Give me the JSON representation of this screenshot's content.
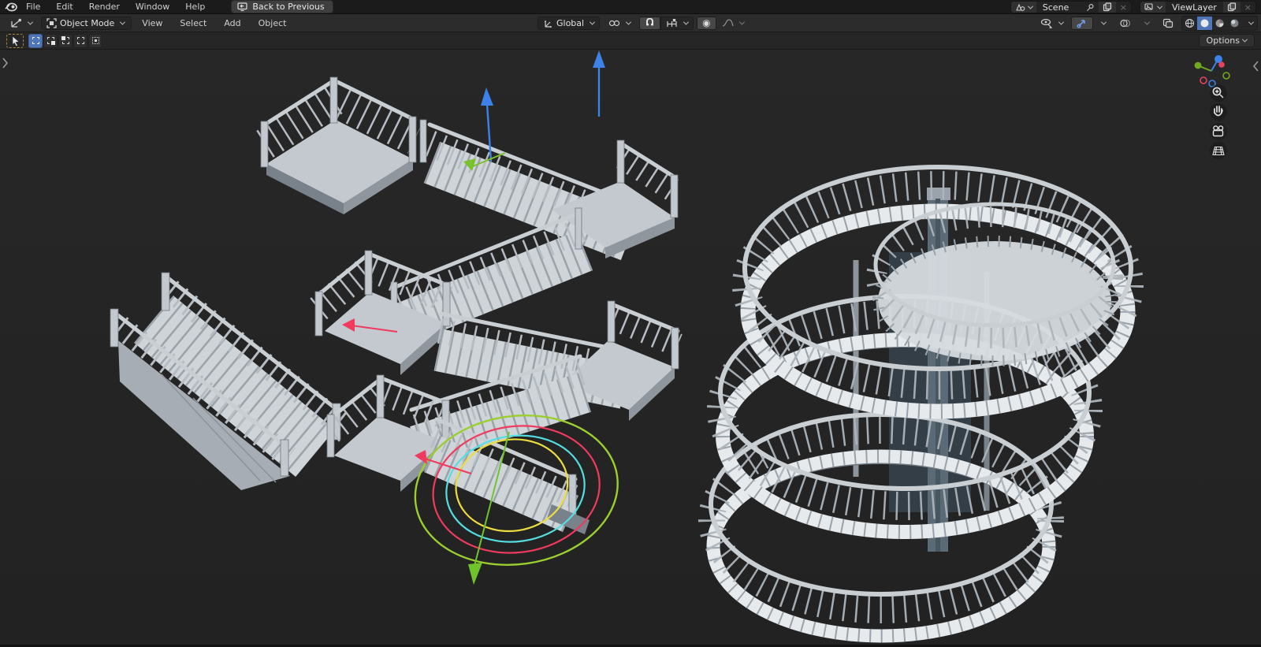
{
  "topbar": {
    "menus": [
      "File",
      "Edit",
      "Render",
      "Window",
      "Help"
    ],
    "back_button": "Back to Previous",
    "scene_name": "Scene",
    "view_layer_name": "ViewLayer",
    "close_glyph": "×"
  },
  "header": {
    "mode": "Object Mode",
    "menus": [
      "View",
      "Select",
      "Add",
      "Object"
    ],
    "orientation": "Global",
    "options_button": "Options",
    "proportional_glyph": "◉"
  },
  "colors": {
    "accent_blue": "#4f76b8",
    "axis_x_red": "#f03a5e",
    "axis_y_green": "#7ac12c",
    "axis_z_blue": "#3d82e8",
    "ring_green": "#9bce2f",
    "ring_red": "#f03a5e",
    "ring_cyan": "#55dee2",
    "ring_yellow": "#eddd40",
    "header_bg": "#2c2c2c",
    "topbar_bg": "#1b1b1b",
    "viewport_bg": "#242424"
  },
  "icons": {
    "blender-logo": "orange app logo",
    "back-icon": "monitor with left arrow",
    "editor-type-icon": "3d viewport axes",
    "object-mode-icon": "bracketed square",
    "orientation-icon": "global axes",
    "pivot-icon": "linked circles",
    "snap-magnet-icon": "magnet (enabled)",
    "snap-target-icon": "increment markers",
    "proportional-icon": "◉",
    "falloff-icon": "curve",
    "visibility-icon": "eye with cursor",
    "gizmo-icon": "blue arrow gizmo",
    "overlays-icon": "overlapping circles",
    "xray-icon": "overlapping squares",
    "shading-wireframe-icon": "wire sphere",
    "shading-solid-icon": "solid sphere (active)",
    "shading-material-icon": "checker sphere",
    "shading-rendered-icon": "shaded sphere",
    "scene-icon": "cone and sphere",
    "pin-icon": "pin",
    "duplicate-icon": "copy pages",
    "view-layer-icon": "layer stack",
    "tweak-tool-icon": "cursor arrow",
    "select-box-icon": "dashed square",
    "zoom-icon": "magnifier plus",
    "pan-icon": "hand",
    "camera-view-icon": "camera",
    "perspective-grid-icon": "grid"
  },
  "viewport": {
    "objects": [
      "straight-staircase",
      "switchback-staircase",
      "spiral-staircase"
    ],
    "overlays": [
      "rotation-rings",
      "x-axis-arrow",
      "y-axis-arrow",
      "z-axis-arrows",
      "navigation-gizmo"
    ]
  }
}
